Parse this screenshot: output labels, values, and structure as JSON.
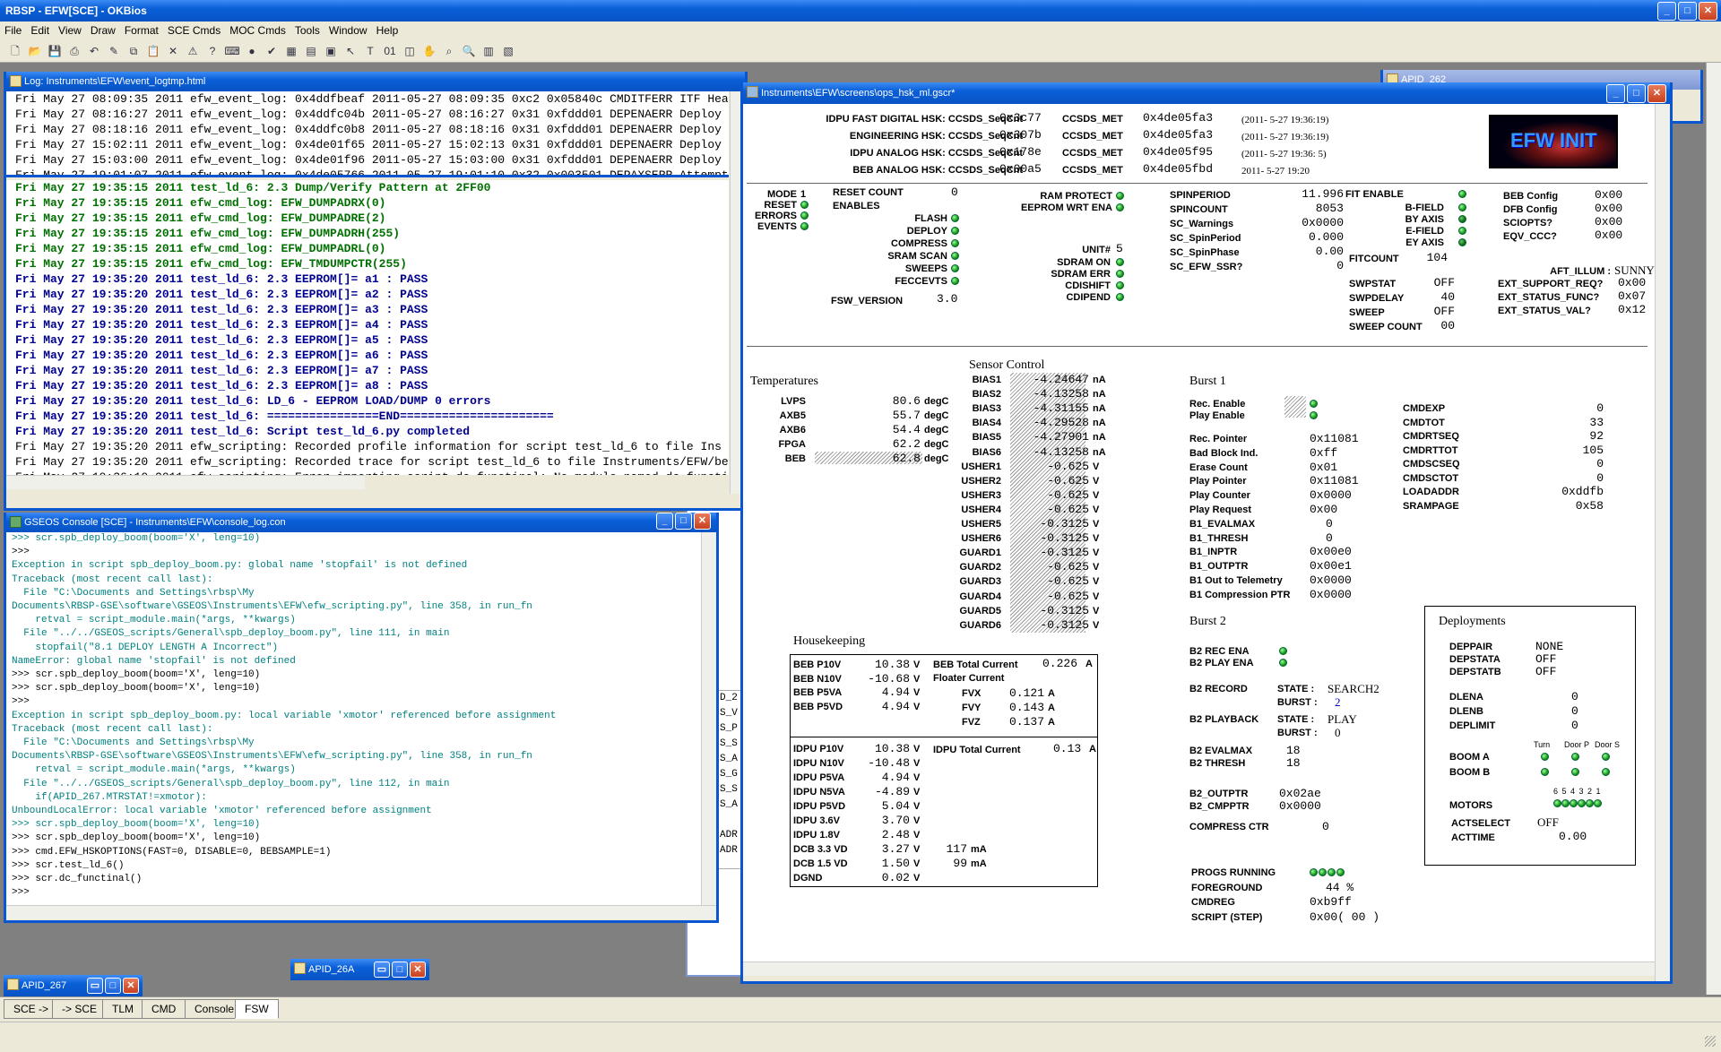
{
  "app": {
    "title": "RBSP - EFW[SCE] - OKBios"
  },
  "menu": [
    "File",
    "Edit",
    "View",
    "Draw",
    "Format",
    "SCE Cmds",
    "MOC Cmds",
    "Tools",
    "Window",
    "Help"
  ],
  "toolbar_icons": [
    "new-file-icon",
    "open-folder-icon",
    "save-icon",
    "print-icon",
    "undo-icon",
    "pen-icon",
    "copy-icon",
    "paste-icon",
    "delete-icon",
    "warning-icon",
    "help-icon",
    "keyboard-icon",
    "globe-icon",
    "check-icon",
    "table-icon",
    "data-icon",
    "sel-icon",
    "arrow-icon",
    "text-icon",
    "binary-icon",
    "obj-icon",
    "hand-icon",
    "zoom-icon",
    "search-icon",
    "window-tile-icon",
    "window-cascade-icon"
  ],
  "log_window": {
    "title": "Log: Instruments\\EFW\\event_logtmp.html",
    "top_lines": [
      "Fri May 27 08:09:35 2011 efw_event_log: 0x4ddfbeaf 2011-05-27 08:09:35 0xc2 0x05840c CMDITFERR ITF Hea",
      "Fri May 27 08:16:27 2011 efw_event_log: 0x4ddfc04b 2011-05-27 08:16:27 0x31 0xfddd01 DEPENAERR Deploy",
      "Fri May 27 08:18:16 2011 efw_event_log: 0x4ddfc0b8 2011-05-27 08:18:16 0x31 0xfddd01 DEPENAERR Deploy",
      "Fri May 27 15:02:11 2011 efw_event_log: 0x4de01f65 2011-05-27 15:02:13 0x31 0xfddd01 DEPENAERR Deploy",
      "Fri May 27 15:03:00 2011 efw_event_log: 0x4de01f96 2011-05-27 15:03:00 0x31 0xfddd01 DEPENAERR Deploy",
      "Fri May 27 19:01:07 2011 efw_event_log: 0x4de05766 2011-05-27 19:01:10 0x32 0x003501 DEPAXSERR Attempt"
    ],
    "lines": [
      {
        "c": "#007000",
        "b": true,
        "t": "Fri May 27 19:35:15 2011 test_ld_6: 2.3 Dump/Verify Pattern at 2FF00"
      },
      {
        "c": "#007000",
        "b": true,
        "t": "Fri May 27 19:35:15 2011 efw_cmd_log: EFW_DUMPADRX(0)"
      },
      {
        "c": "#007000",
        "b": true,
        "t": "Fri May 27 19:35:15 2011 efw_cmd_log: EFW_DUMPADRE(2)"
      },
      {
        "c": "#007000",
        "b": true,
        "t": "Fri May 27 19:35:15 2011 efw_cmd_log: EFW_DUMPADRH(255)"
      },
      {
        "c": "#007000",
        "b": true,
        "t": "Fri May 27 19:35:15 2011 efw_cmd_log: EFW_DUMPADRL(0)"
      },
      {
        "c": "#007000",
        "b": true,
        "t": "Fri May 27 19:35:15 2011 efw_cmd_log: EFW_TMDUMPCTR(255)"
      },
      {
        "c": "#000090",
        "b": true,
        "t": "Fri May 27 19:35:20 2011 test_ld_6: 2.3 EEPROM[]= a1 : PASS"
      },
      {
        "c": "#000090",
        "b": true,
        "t": "Fri May 27 19:35:20 2011 test_ld_6: 2.3 EEPROM[]= a2 : PASS"
      },
      {
        "c": "#000090",
        "b": true,
        "t": "Fri May 27 19:35:20 2011 test_ld_6: 2.3 EEPROM[]= a3 : PASS"
      },
      {
        "c": "#000090",
        "b": true,
        "t": "Fri May 27 19:35:20 2011 test_ld_6: 2.3 EEPROM[]= a4 : PASS"
      },
      {
        "c": "#000090",
        "b": true,
        "t": "Fri May 27 19:35:20 2011 test_ld_6: 2.3 EEPROM[]= a5 : PASS"
      },
      {
        "c": "#000090",
        "b": true,
        "t": "Fri May 27 19:35:20 2011 test_ld_6: 2.3 EEPROM[]= a6 : PASS"
      },
      {
        "c": "#000090",
        "b": true,
        "t": "Fri May 27 19:35:20 2011 test_ld_6: 2.3 EEPROM[]= a7 : PASS"
      },
      {
        "c": "#000090",
        "b": true,
        "t": "Fri May 27 19:35:20 2011 test_ld_6: 2.3 EEPROM[]= a8 : PASS"
      },
      {
        "c": "#000090",
        "b": true,
        "t": "Fri May 27 19:35:20 2011 test_ld_6: LD_6 - EEPROM LOAD/DUMP 0 errors"
      },
      {
        "c": "#000090",
        "b": true,
        "t": "Fri May 27 19:35:20 2011 test_ld_6: ================END======================"
      },
      {
        "c": "#000090",
        "b": true,
        "t": "Fri May 27 19:35:20 2011 test_ld_6: Script test_ld_6.py completed"
      },
      {
        "c": "#000",
        "b": false,
        "t": "Fri May 27 19:35:20 2011 efw_scripting: Recorded profile information for script test_ld_6 to file Ins"
      },
      {
        "c": "#000",
        "b": false,
        "t": "Fri May 27 19:35:20 2011 efw_scripting: Recorded trace for script test_ld_6 to file Instruments/EFW/be"
      },
      {
        "c": "#000",
        "b": false,
        "t": "Fri May 27 19:36:10 2011 efw_scripting: Error importing script dc_functinal: No module named dc_functi"
      }
    ]
  },
  "gseos": {
    "title": "GSEOS Console  [SCE] - Instruments\\EFW\\console_log.con",
    "lines": [
      {
        "k": 0,
        "t": ">>> scr.spb_deploy_boom(boom='X', leng=10)"
      },
      {
        "k": 1,
        "t": ">>>"
      },
      {
        "k": 0,
        "t": "Exception in script spb_deploy_boom.py: global name 'stopfail' is not defined"
      },
      {
        "k": 0,
        "t": "Traceback (most recent call last):"
      },
      {
        "k": 0,
        "t": "  File \"C:\\Documents and Settings\\rbsp\\My"
      },
      {
        "k": 0,
        "t": "Documents\\RBSP-GSE\\software\\GSEOS\\Instruments\\EFW\\efw_scripting.py\", line 358, in run_fn"
      },
      {
        "k": 0,
        "t": "    retval = script_module.main(*args, **kwargs)"
      },
      {
        "k": 0,
        "t": "  File \"../../GSEOS_scripts/General\\spb_deploy_boom.py\", line 111, in main"
      },
      {
        "k": 0,
        "t": "    stopfail(\"8.1 DEPLOY LENGTH A Incorrect\")"
      },
      {
        "k": 0,
        "t": "NameError: global name 'stopfail' is not defined"
      },
      {
        "k": 1,
        "t": ">>> scr.spb_deploy_boom(boom='X', leng=10)"
      },
      {
        "k": 1,
        "t": ">>> scr.spb_deploy_boom(boom='X', leng=10)"
      },
      {
        "k": 1,
        "t": ">>>"
      },
      {
        "k": 0,
        "t": "Exception in script spb_deploy_boom.py: local variable 'xmotor' referenced before assignment"
      },
      {
        "k": 0,
        "t": "Traceback (most recent call last):"
      },
      {
        "k": 0,
        "t": "  File \"C:\\Documents and Settings\\rbsp\\My"
      },
      {
        "k": 0,
        "t": "Documents\\RBSP-GSE\\software\\GSEOS\\Instruments\\EFW\\efw_scripting.py\", line 358, in run_fn"
      },
      {
        "k": 0,
        "t": "    retval = script_module.main(*args, **kwargs)"
      },
      {
        "k": 0,
        "t": "  File \"../../GSEOS_scripts/General\\spb_deploy_boom.py\", line 112, in main"
      },
      {
        "k": 0,
        "t": "    if(APID_267.MTRSTAT!=xmotor):"
      },
      {
        "k": 0,
        "t": "UnboundLocalError: local variable 'xmotor' referenced before assignment"
      },
      {
        "k": 0,
        "t": ">>> scr.spb_deploy_boom(boom='X', leng=10)"
      },
      {
        "k": 1,
        "t": ">>> scr.spb_deploy_boom(boom='X', leng=10)"
      },
      {
        "k": 1,
        "t": ">>> cmd.EFW_HSKOPTIONS(FAST=0, DISABLE=0, BEBSAMPLE=1)"
      },
      {
        "k": 1,
        "t": ">>> scr.test_ld_6()"
      },
      {
        "k": 1,
        "t": ">>> scr.dc_functinal()"
      },
      {
        "k": 1,
        "t": ">>>"
      }
    ]
  },
  "hsk_window": {
    "title": "Instruments\\EFW\\screens\\ops_hsk_ml.gscr*",
    "logo_text": "EFW INIT",
    "header_rows": [
      {
        "label": "IDPU FAST DIGITAL HSK: CCSDS_SeqCnt",
        "seq": "0x3c77",
        "met": "0x4de05fa3",
        "time": "(2011- 5-27  19:36:19)"
      },
      {
        "label": "ENGINEERING HSK: CCSDS_SeqCnt",
        "seq": "0x307b",
        "met": "0x4de05fa3",
        "time": "(2011- 5-27  19:36:19)"
      },
      {
        "label": "IDPU ANALOG HSK: CCSDS_SeqCnt",
        "seq": "0x178e",
        "met": "0x4de05f95",
        "time": "(2011- 5-27  19:36: 5)"
      },
      {
        "label": "BEB ANALOG HSK: CCSDS_SeqCnt",
        "seq": "0x00a5",
        "met": "0x4de05fbd",
        "time": "2011- 5-27  19:20"
      }
    ],
    "met_label": "CCSDS_MET",
    "mode": {
      "labels": [
        "MODE",
        "RESET",
        "ERRORS",
        "EVENTS"
      ],
      "mode_val": "1"
    },
    "reset_count": {
      "label": "RESET COUNT",
      "value": "0"
    },
    "enables": {
      "title": "ENABLES",
      "items": [
        "FLASH",
        "DEPLOY",
        "COMPRESS",
        "SRAM SCAN",
        "SWEEPS",
        "FECCEVTS"
      ]
    },
    "fsw_version": {
      "label": "FSW_VERSION",
      "value": "3.0"
    },
    "ram": {
      "items": [
        "RAM PROTECT",
        "EEPROM WRT ENA"
      ]
    },
    "unit": {
      "label": "UNIT#",
      "value": "5",
      "items": [
        "SDRAM ON",
        "SDRAM ERR",
        "CDISHIFT",
        "CDIPEND"
      ]
    },
    "spin": [
      {
        "l": "SPINPERIOD",
        "v": "11.996"
      },
      {
        "l": "SPINCOUNT",
        "v": "8053"
      },
      {
        "l": "SC_Warnings",
        "v": "0x0000"
      },
      {
        "l": "SC_SpinPeriod",
        "v": "0.000"
      },
      {
        "l": "SC_SpinPhase",
        "v": "0.00"
      },
      {
        "l": "SC_EFW_SSR?",
        "v": "0"
      }
    ],
    "fit": {
      "title": "FIT ENABLE",
      "items": [
        "B-FIELD",
        "BY AXIS",
        "E-FIELD",
        "EY AXIS"
      ],
      "count_label": "FITCOUNT",
      "count": "104"
    },
    "swp": [
      {
        "l": "SWPSTAT",
        "v": "OFF"
      },
      {
        "l": "SWPDELAY",
        "v": "40"
      },
      {
        "l": "SWEEP",
        "v": "OFF"
      },
      {
        "l": "SWEEP COUNT",
        "v": "00"
      }
    ],
    "cfg": [
      {
        "l": "BEB Config",
        "v": "0x00"
      },
      {
        "l": "DFB Config",
        "v": "0x00"
      },
      {
        "l": "SCIOPTS?",
        "v": "0x00"
      },
      {
        "l": "EQV_CCC?",
        "v": "0x00"
      }
    ],
    "aft": {
      "label": "AFT_ILLUM :",
      "value": "SUNNY"
    },
    "ext": [
      {
        "l": "EXT_SUPPORT_REQ?",
        "v": "0x00"
      },
      {
        "l": "EXT_STATUS_FUNC?",
        "v": "0x07"
      },
      {
        "l": "EXT_STATUS_VAL?",
        "v": "0x12"
      }
    ],
    "temps": {
      "title": "Temperatures",
      "rows": [
        {
          "l": "LVPS",
          "v": "80.6",
          "u": "degC"
        },
        {
          "l": "AXB5",
          "v": "55.7",
          "u": "degC"
        },
        {
          "l": "AXB6",
          "v": "54.4",
          "u": "degC"
        },
        {
          "l": "FPGA",
          "v": "62.2",
          "u": "degC"
        },
        {
          "l": "BEB",
          "v": "62.8",
          "u": "degC"
        }
      ]
    },
    "sensor": {
      "title": "Sensor Control",
      "rows": [
        {
          "l": "BIAS1",
          "v": "-4.24647",
          "u": "nA"
        },
        {
          "l": "BIAS2",
          "v": "-4.13258",
          "u": "nA"
        },
        {
          "l": "BIAS3",
          "v": "-4.31155",
          "u": "nA"
        },
        {
          "l": "BIAS4",
          "v": "-4.29528",
          "u": "nA"
        },
        {
          "l": "BIAS5",
          "v": "-4.27901",
          "u": "nA"
        },
        {
          "l": "BIAS6",
          "v": "-4.13258",
          "u": "nA"
        },
        {
          "l": "USHER1",
          "v": "-0.625",
          "u": "V"
        },
        {
          "l": "USHER2",
          "v": "-0.625",
          "u": "V"
        },
        {
          "l": "USHER3",
          "v": "-0.625",
          "u": "V"
        },
        {
          "l": "USHER4",
          "v": "-0.625",
          "u": "V"
        },
        {
          "l": "USHER5",
          "v": "-0.3125",
          "u": "V"
        },
        {
          "l": "USHER6",
          "v": "-0.3125",
          "u": "V"
        },
        {
          "l": "GUARD1",
          "v": "-0.3125",
          "u": "V"
        },
        {
          "l": "GUARD2",
          "v": "-0.625",
          "u": "V"
        },
        {
          "l": "GUARD3",
          "v": "-0.625",
          "u": "V"
        },
        {
          "l": "GUARD4",
          "v": "-0.625",
          "u": "V"
        },
        {
          "l": "GUARD5",
          "v": "-0.3125",
          "u": "V"
        },
        {
          "l": "GUARD6",
          "v": "-0.3125",
          "u": "V"
        }
      ]
    },
    "house": {
      "title": "Housekeeping",
      "beb": [
        {
          "l": "BEB P10V",
          "v": "10.38",
          "u": "V"
        },
        {
          "l": "BEB N10V",
          "v": "-10.68",
          "u": "V"
        },
        {
          "l": "BEB P5VA",
          "v": "4.94",
          "u": "V"
        },
        {
          "l": "BEB P5VD",
          "v": "4.94",
          "u": "V"
        }
      ],
      "beb_total": {
        "l": "BEB Total Current",
        "v": "0.226",
        "u": "A"
      },
      "floater": {
        "l": "Floater Current",
        "rows": [
          {
            "l": "FVX",
            "v": "0.121",
            "u": "A"
          },
          {
            "l": "FVY",
            "v": "0.143",
            "u": "A"
          },
          {
            "l": "FVZ",
            "v": "0.137",
            "u": "A"
          }
        ]
      },
      "idpu": [
        {
          "l": "IDPU P10V",
          "v": "10.38",
          "u": "V"
        },
        {
          "l": "IDPU N10V",
          "v": "-10.48",
          "u": "V"
        },
        {
          "l": "IDPU P5VA",
          "v": "4.94",
          "u": "V"
        },
        {
          "l": "IDPU N5VA",
          "v": "-4.89",
          "u": "V"
        },
        {
          "l": "IDPU P5VD",
          "v": "5.04",
          "u": "V"
        },
        {
          "l": "IDPU 3.6V",
          "v": "3.70",
          "u": "V"
        },
        {
          "l": "IDPU 1.8V",
          "v": "2.48",
          "u": "V"
        },
        {
          "l": "DCB 3.3 VD",
          "v": "3.27",
          "u": "V"
        },
        {
          "l": "DCB 1.5 VD",
          "v": "1.50",
          "u": "V"
        },
        {
          "l": "DGND",
          "v": "0.02",
          "u": "V"
        }
      ],
      "idpu_total": {
        "l": "IDPU Total Current",
        "v": "0.13",
        "u": "A"
      },
      "dcb_ma": [
        {
          "v": "117",
          "u": "mA"
        },
        {
          "v": "99",
          "u": "mA"
        }
      ]
    },
    "burst1": {
      "title": "Burst 1",
      "enables": [
        "Rec. Enable",
        "Play Enable"
      ],
      "rows": [
        {
          "l": "Rec. Pointer",
          "v": "0x11081"
        },
        {
          "l": "Bad Block Ind.",
          "v": "0xff"
        },
        {
          "l": "Erase Count",
          "v": "0x01"
        },
        {
          "l": "Play Pointer",
          "v": "0x11081"
        },
        {
          "l": "Play Counter",
          "v": "0x0000"
        },
        {
          "l": "Play Request",
          "v": "0x00"
        },
        {
          "l": "B1_EVALMAX",
          "v": "0"
        },
        {
          "l": "B1_THRESH",
          "v": "0"
        },
        {
          "l": "B1_INPTR",
          "v": "0x00e0"
        },
        {
          "l": "B1_OUTPTR",
          "v": "0x00e1"
        },
        {
          "l": "B1 Out to Telemetry",
          "v": "0x0000"
        },
        {
          "l": "B1 Compression PTR",
          "v": "0x0000"
        }
      ]
    },
    "cmd": [
      {
        "l": "CMDEXP",
        "v": "0"
      },
      {
        "l": "CMDTOT",
        "v": "33"
      },
      {
        "l": "CMDRTSEQ",
        "v": "92"
      },
      {
        "l": "CMDRTTOT",
        "v": "105"
      },
      {
        "l": "CMDSCSEQ",
        "v": "0"
      },
      {
        "l": "CMDSCTOT",
        "v": "0"
      },
      {
        "l": "LOADADDR",
        "v": "0xddfb"
      },
      {
        "l": "SRAMPAGE",
        "v": "0x58"
      }
    ],
    "burst2": {
      "title": "Burst 2",
      "enables": [
        "B2 REC ENA",
        "B2 PLAY ENA"
      ],
      "record": {
        "l": "B2 RECORD",
        "state_l": "STATE :",
        "state": "SEARCH2",
        "burst_l": "BURST :",
        "burst": "2"
      },
      "playback": {
        "l": "B2 PLAYBACK",
        "state_l": "STATE :",
        "state": "PLAY",
        "burst_l": "BURST :",
        "burst": "0"
      },
      "rows": [
        {
          "l": "B2 EVALMAX",
          "v": "18"
        },
        {
          "l": "B2 THRESH",
          "v": "18"
        }
      ],
      "ptr": [
        {
          "l": "B2_OUTPTR",
          "v": "0x02ae"
        },
        {
          "l": "B2_CMPPTR",
          "v": "0x0000"
        }
      ],
      "compress": {
        "l": "COMPRESS CTR",
        "v": "0"
      }
    },
    "progs": [
      {
        "l": "PROGS RUNNING",
        "v": ""
      },
      {
        "l": "FOREGROUND",
        "v": "44 %"
      },
      {
        "l": "CMDREG",
        "v": "0xb9ff"
      },
      {
        "l": "SCRIPT (STEP)",
        "v": "0x00( 00 )"
      }
    ],
    "deploy": {
      "title": "Deployments",
      "rows": [
        {
          "l": "DEPPAIR",
          "v": "NONE"
        },
        {
          "l": "DEPSTATA",
          "v": "OFF"
        },
        {
          "l": "DEPSTATB",
          "v": "OFF"
        },
        {
          "l": "DLENA",
          "v": "0"
        },
        {
          "l": "DLENB",
          "v": "0"
        },
        {
          "l": "DEPLIMIT",
          "v": "0"
        }
      ],
      "cols": [
        "Turn",
        "Door P",
        "Door S"
      ],
      "booms": [
        "BOOM A",
        "BOOM B"
      ],
      "motors_l": "MOTORS",
      "motors_nums": "6 5 4 3 2 1",
      "actselect": {
        "l": "ACTSELECT",
        "v": "OFF"
      },
      "acttime": {
        "l": "ACTTIME",
        "v": "0.00"
      }
    }
  },
  "bg_windows": {
    "apid262": "APID_262",
    "apid267": "APID_267",
    "apid26a": "APID_26A"
  },
  "bottom_tabs": [
    "SCE ->",
    "-> SCE",
    "TLM",
    "CMD",
    "Console",
    "FSW"
  ],
  "colors": {
    "xp_blue": "#0a56d0",
    "led_green": "#1a9a1a",
    "log_green": "#007000",
    "log_blue": "#000090",
    "console_teal": "#008080"
  }
}
